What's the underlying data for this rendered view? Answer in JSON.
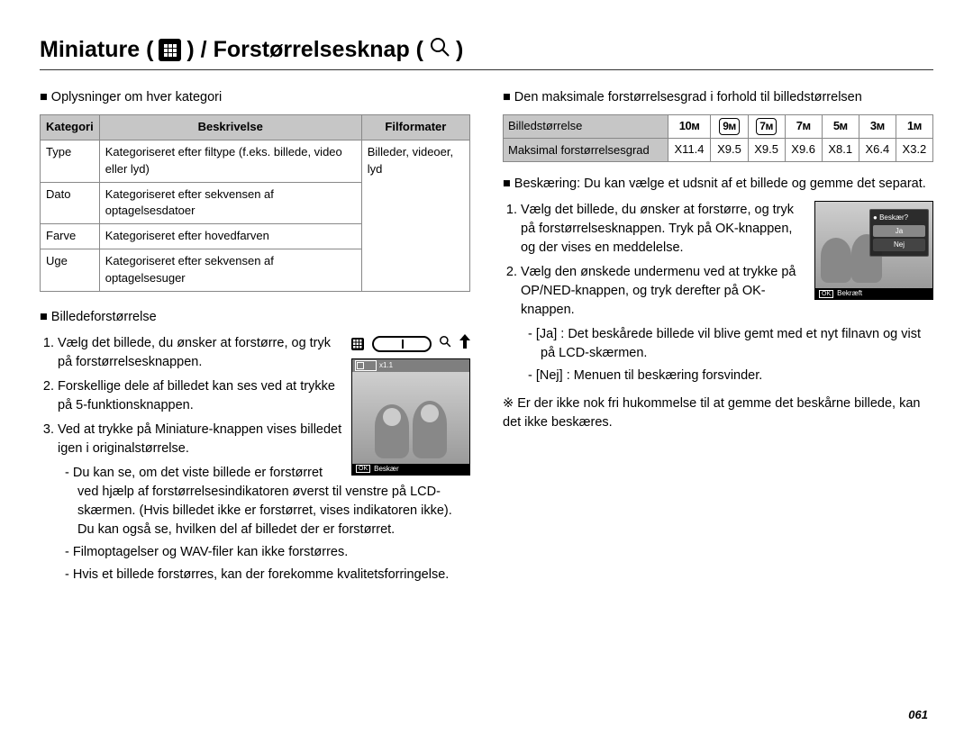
{
  "page_number": "061",
  "heading": {
    "part1": "Miniature ( ",
    "part2": " ) / Forstørrelsesknap ( ",
    "part3": " )"
  },
  "left": {
    "section1_title": "Oplysninger om hver kategori",
    "cat_table": {
      "headers": [
        "Kategori",
        "Beskrivelse",
        "Filformater"
      ],
      "rows": [
        {
          "k": "Type",
          "b": "Kategoriseret efter filtype (f.eks. billede, video eller lyd)",
          "f": ""
        },
        {
          "k": "Dato",
          "b": "Kategoriseret efter sekvensen af optagelsesdatoer",
          "f": "Billeder, videoer, lyd"
        },
        {
          "k": "Farve",
          "b": "Kategoriseret efter hovedfarven",
          "f": ""
        },
        {
          "k": "Uge",
          "b": "Kategoriseret efter sekvensen af optagelsesuger",
          "f": ""
        }
      ]
    },
    "section2_title": "Billedeforstørrelse",
    "steps": [
      "Vælg det billede, du ønsker at forstørre, og tryk på forstørrelsesknappen.",
      "Forskellige dele af billedet kan ses ved at trykke på 5-funktionsknappen.",
      "Ved at trykke på Miniature-knappen vises billedet igen i originalstørrelse."
    ],
    "notes": [
      "- Du kan se, om det viste billede er forstørret ved hjælp af forstørrelsesindikatoren øverst til venstre på LCD-skærmen. (Hvis billedet ikke er forstørret, vises indikatoren ikke). Du kan også se, hvilken del af billedet der er forstørret.",
      "- Filmoptagelser og WAV-filer kan ikke forstørres.",
      "- Hvis et billede forstørres, kan der forekomme kvalitetsforringelse."
    ],
    "lcd_zoom_label": "x1.1",
    "lcd_bottom_label": "Beskær",
    "lcd_ok": "OK"
  },
  "right": {
    "section1_title": "Den maksimale forstørrelsesgrad i forhold til billedstørrelsen",
    "zoom_table": {
      "row1_label": "Billedstørrelse",
      "row2_label": "Maksimal forstørrelsesgrad",
      "sizes": [
        "10ᴍ",
        "9ᴍ",
        "7ᴍ",
        "7ᴍ",
        "5ᴍ",
        "3ᴍ",
        "1ᴍ"
      ],
      "size_boxed": [
        false,
        true,
        true,
        false,
        false,
        false,
        false
      ],
      "zoom": [
        "X11.4",
        "X9.5",
        "X9.5",
        "X9.6",
        "X8.1",
        "X6.4",
        "X3.2"
      ]
    },
    "crop_intro": "Beskæring: Du kan vælge et udsnit af et billede og gemme det separat.",
    "crop_steps": [
      "Vælg det billede, du ønsker at forstørre, og tryk på forstørrelsesknappen. Tryk på OK-knappen, og der vises en meddelelse.",
      "Vælg den ønskede undermenu ved at trykke på OP/NED-knappen, og tryk derefter på OK-knappen."
    ],
    "crop_options": [
      "- [Ja]  : Det beskårede billede vil blive gemt med et nyt filnavn og vist på LCD-skærmen.",
      "- [Nej] : Menuen til beskæring forsvinder."
    ],
    "star_note": "Er der ikke nok fri hukommelse til at gemme det beskårne billede, kan det ikke beskæres.",
    "dialog": {
      "title": "Beskær?",
      "opt_yes": "Ja",
      "opt_no": "Nej"
    },
    "lcd_bottom_label": "Bekræft",
    "lcd_ok": "OK"
  }
}
